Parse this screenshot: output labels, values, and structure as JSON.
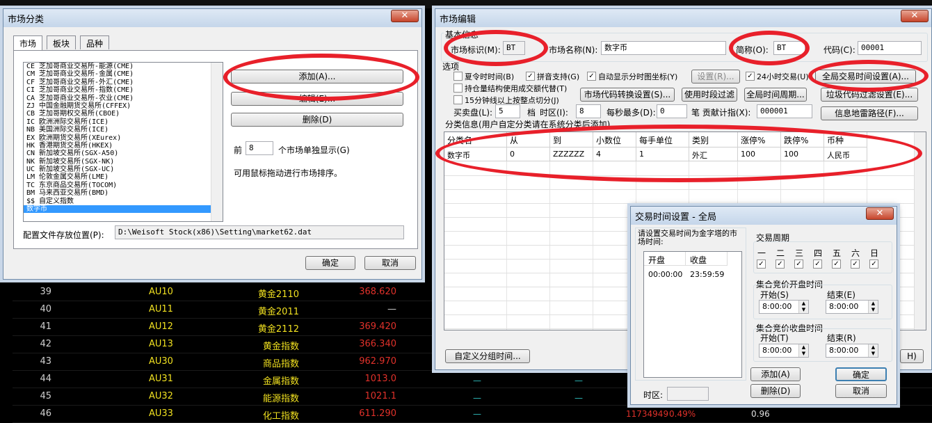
{
  "background": {
    "rows": [
      {
        "num": "39",
        "code": "AU10",
        "name": "黄金2110",
        "price": "368.620"
      },
      {
        "num": "40",
        "code": "AU11",
        "name": "黄金2011",
        "price": "—"
      },
      {
        "num": "41",
        "code": "AU12",
        "name": "黄金2112",
        "price": "369.420"
      },
      {
        "num": "42",
        "code": "AU13",
        "name": "黄金指数",
        "price": "366.340"
      },
      {
        "num": "43",
        "code": "AU30",
        "name": "商品指数",
        "price": "962.970"
      },
      {
        "num": "44",
        "code": "AU31",
        "name": "金属指数",
        "price": "1013.0"
      },
      {
        "num": "45",
        "code": "AU32",
        "name": "能源指数",
        "price": "1021.1"
      },
      {
        "num": "46",
        "code": "AU33",
        "name": "化工指数",
        "price": "611.290"
      }
    ],
    "extra_vol": "11734949",
    "extra_pct": "0.49%",
    "extra_val": "0.96",
    "dash": "—"
  },
  "market_dialog": {
    "title": "市场分类",
    "close": "✕",
    "tabs": [
      "市场",
      "板块",
      "品种"
    ],
    "items": [
      "CE 芝加哥商业交易所-能源(CME)",
      "CM 芝加哥商业交易所-金属(CME)",
      "CF 芝加哥商业交易所-外汇(CME)",
      "CI 芝加哥商业交易所-指数(CME)",
      "CA 芝加哥商业交易所-农业(CME)",
      "ZJ 中国金融期货交易所(CFFEX)",
      "CB 芝加哥期权交易所(CBOE)",
      "IC 欧洲洲际交易所(ICE)",
      "NB 美国洲际交易所(ICE)",
      "EX 欧洲期货交易所(XEurex)",
      "HK 香港期货交易所(HKEX)",
      "CN 新加坡交易所(SGX-A50)",
      "NK 新加坡交易所(SGX-NK)",
      "UC 新加坡交易所(SGX-UC)",
      "LM 伦敦金属交易所(LME)",
      "TC 东京商品交易所(TOCOM)",
      "BM 马来西亚交易所(BMD)",
      "$$ 自定义指数",
      "数字币"
    ],
    "btn_add": "添加(A)...",
    "btn_edit": "编辑(E)...",
    "btn_delete": "删除(D)",
    "front_label": "前",
    "front_value": "8",
    "front_suffix": "个市场单独显示(G)",
    "drag_hint": "可用鼠标拖动进行市场排序。",
    "config_label": "配置文件存放位置(P):",
    "config_path": "D:\\Weisoft Stock(x86)\\Setting\\market62.dat",
    "ok": "确定",
    "cancel": "取消"
  },
  "edit_dialog": {
    "title": "市场编辑",
    "close": "✕",
    "basic_info": "基本信息",
    "market_id_label": "市场标识(M):",
    "market_id": "BT",
    "market_name_label": "市场名称(N):",
    "market_name": "数字币",
    "abbr_label": "简称(O):",
    "abbr": "BT",
    "code_label": "代码(C):",
    "code": "00001",
    "options": "选项",
    "cb_dst": "夏令时时间(B)",
    "cb_pinyin": "拼音支持(G)",
    "cb_autocoord": "自动显示分时图坐标(Y)",
    "btn_settings": "设置(R)...",
    "cb_24h": "24小时交易(U)",
    "btn_global_time": "全局交易时间设置(A)...",
    "cb_position": "持仓量结构使用成交额代替(T)",
    "btn_code_convert": "市场代码转换设置(S)...",
    "btn_use_period": "使用时段过滤",
    "btn_global_period": "全局时间周期...",
    "btn_garbage": "垃圾代码过滤设置(E)...",
    "cb_15min": "15分钟线以上按整点切分(J)",
    "buysell_label": "买卖盘(L):",
    "buysell": "5",
    "tz_prefix": "档",
    "tz_label": "时区(I):",
    "tz": "8",
    "persec_label": "每秒最多(D):",
    "persec": "0",
    "contrib_label": "笔 贡献计指(X):",
    "contrib": "000001",
    "btn_info_path": "信息地雷路径(F)...",
    "class_info": "分类信息(用户自定分类请在系统分类后添加)",
    "columns": [
      "分类名",
      "从",
      "到",
      "小数位",
      "每手单位",
      "类别",
      "涨停%",
      "跌停%",
      "币种"
    ],
    "row": [
      "数字币",
      "0",
      "ZZZZZZ",
      "4",
      "1",
      "外汇",
      "100",
      "100",
      "人民币"
    ],
    "btn_custom_group": "自定义分组时间...",
    "btn_partial": "H)"
  },
  "time_dialog": {
    "title": "交易时间设置 - 全局",
    "close": "✕",
    "desc": "请设置交易时间为金字塔的市场时间:",
    "col_open": "开盘",
    "col_close": "收盘",
    "open": "00:00:00",
    "close_time": "23:59:59",
    "tz_label": "时区:",
    "cycle_label": "交易周期",
    "days": [
      "一",
      "二",
      "三",
      "四",
      "五",
      "六",
      "日"
    ],
    "auction_open": "集合竞价开盘时间",
    "auction_close": "集合竞价收盘时间",
    "start_s": "开始(S)",
    "end_e": "结束(E)",
    "start_t": "开始(T)",
    "end_r": "结束(R)",
    "time1": "8:00:00",
    "time2": "8:00:00",
    "time3": "8:00:00",
    "time4": "8:00:00",
    "btn_add": "添加(A)",
    "btn_delete": "删除(D)",
    "ok": "确定",
    "cancel": "取消"
  },
  "colors": {
    "annotation": "#e8202a",
    "selected": "#3399ff",
    "quote_red": "#e0312a",
    "quote_yellow": "#f0e020"
  }
}
